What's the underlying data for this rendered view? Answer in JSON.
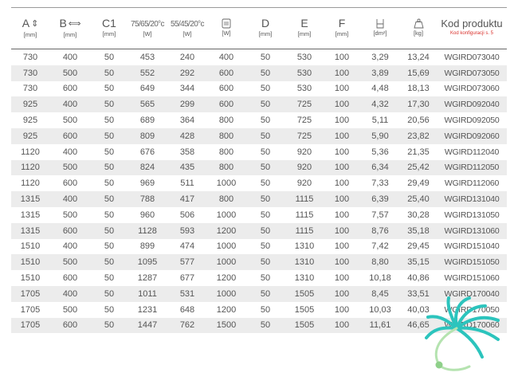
{
  "header": {
    "columns": [
      {
        "label": "A",
        "icon": "up-down-arrow-icon",
        "unit": "[mm]"
      },
      {
        "label": "B",
        "icon": "left-right-arrow-icon",
        "unit": "[mm]"
      },
      {
        "label": "C1",
        "unit": "[mm]"
      },
      {
        "label": "75/65/20°c",
        "unit": "[W]"
      },
      {
        "label": "55/45/20°c",
        "unit": "[W]"
      },
      {
        "icon": "heater-icon",
        "unit": "[W]"
      },
      {
        "label": "D",
        "unit": "[mm]"
      },
      {
        "label": "E",
        "unit": "[mm]"
      },
      {
        "label": "F",
        "unit": "[mm]"
      },
      {
        "icon": "surface-area-icon",
        "unit": "[dm²]"
      },
      {
        "icon": "weight-icon",
        "unit": "[kg]"
      },
      {
        "label": "Kod produktu",
        "note": "Kod konfiguracji s. 5"
      }
    ]
  },
  "rows": [
    [
      "730",
      "400",
      "50",
      "453",
      "240",
      "400",
      "50",
      "530",
      "100",
      "3,29",
      "13,24",
      "WGIRD073040"
    ],
    [
      "730",
      "500",
      "50",
      "552",
      "292",
      "600",
      "50",
      "530",
      "100",
      "3,89",
      "15,69",
      "WGIRD073050"
    ],
    [
      "730",
      "600",
      "50",
      "649",
      "344",
      "600",
      "50",
      "530",
      "100",
      "4,48",
      "18,13",
      "WGIRD073060"
    ],
    [
      "925",
      "400",
      "50",
      "565",
      "299",
      "600",
      "50",
      "725",
      "100",
      "4,32",
      "17,30",
      "WGIRD092040"
    ],
    [
      "925",
      "500",
      "50",
      "689",
      "364",
      "800",
      "50",
      "725",
      "100",
      "5,11",
      "20,56",
      "WGIRD092050"
    ],
    [
      "925",
      "600",
      "50",
      "809",
      "428",
      "800",
      "50",
      "725",
      "100",
      "5,90",
      "23,82",
      "WGIRD092060"
    ],
    [
      "1120",
      "400",
      "50",
      "676",
      "358",
      "800",
      "50",
      "920",
      "100",
      "5,36",
      "21,35",
      "WGIRD112040"
    ],
    [
      "1120",
      "500",
      "50",
      "824",
      "435",
      "800",
      "50",
      "920",
      "100",
      "6,34",
      "25,42",
      "WGIRD112050"
    ],
    [
      "1120",
      "600",
      "50",
      "969",
      "511",
      "1000",
      "50",
      "920",
      "100",
      "7,33",
      "29,49",
      "WGIRD112060"
    ],
    [
      "1315",
      "400",
      "50",
      "788",
      "417",
      "800",
      "50",
      "1115",
      "100",
      "6,39",
      "25,40",
      "WGIRD131040"
    ],
    [
      "1315",
      "500",
      "50",
      "960",
      "506",
      "1000",
      "50",
      "1115",
      "100",
      "7,57",
      "30,28",
      "WGIRD131050"
    ],
    [
      "1315",
      "600",
      "50",
      "1128",
      "593",
      "1200",
      "50",
      "1115",
      "100",
      "8,76",
      "35,18",
      "WGIRD131060"
    ],
    [
      "1510",
      "400",
      "50",
      "899",
      "474",
      "1000",
      "50",
      "1310",
      "100",
      "7,42",
      "29,45",
      "WGIRD151040"
    ],
    [
      "1510",
      "500",
      "50",
      "1095",
      "577",
      "1000",
      "50",
      "1310",
      "100",
      "8,80",
      "35,15",
      "WGIRD151050"
    ],
    [
      "1510",
      "600",
      "50",
      "1287",
      "677",
      "1200",
      "50",
      "1310",
      "100",
      "10,18",
      "40,86",
      "WGIRD151060"
    ],
    [
      "1705",
      "400",
      "50",
      "1011",
      "531",
      "1000",
      "50",
      "1505",
      "100",
      "8,45",
      "33,51",
      "WGIRD170040"
    ],
    [
      "1705",
      "500",
      "50",
      "1231",
      "648",
      "1200",
      "50",
      "1505",
      "100",
      "10,03",
      "40,03",
      "WGIRD170050"
    ],
    [
      "1705",
      "600",
      "50",
      "1447",
      "762",
      "1500",
      "50",
      "1505",
      "100",
      "11,61",
      "46,65",
      "WGIRD170060"
    ]
  ],
  "colors": {
    "logo_teal": "#2cc4bd",
    "logo_green": "#8fd08a",
    "stripe": "#ececec",
    "note_red": "#d9302b"
  },
  "logo": {
    "icon": "brand-swirl-logo"
  }
}
